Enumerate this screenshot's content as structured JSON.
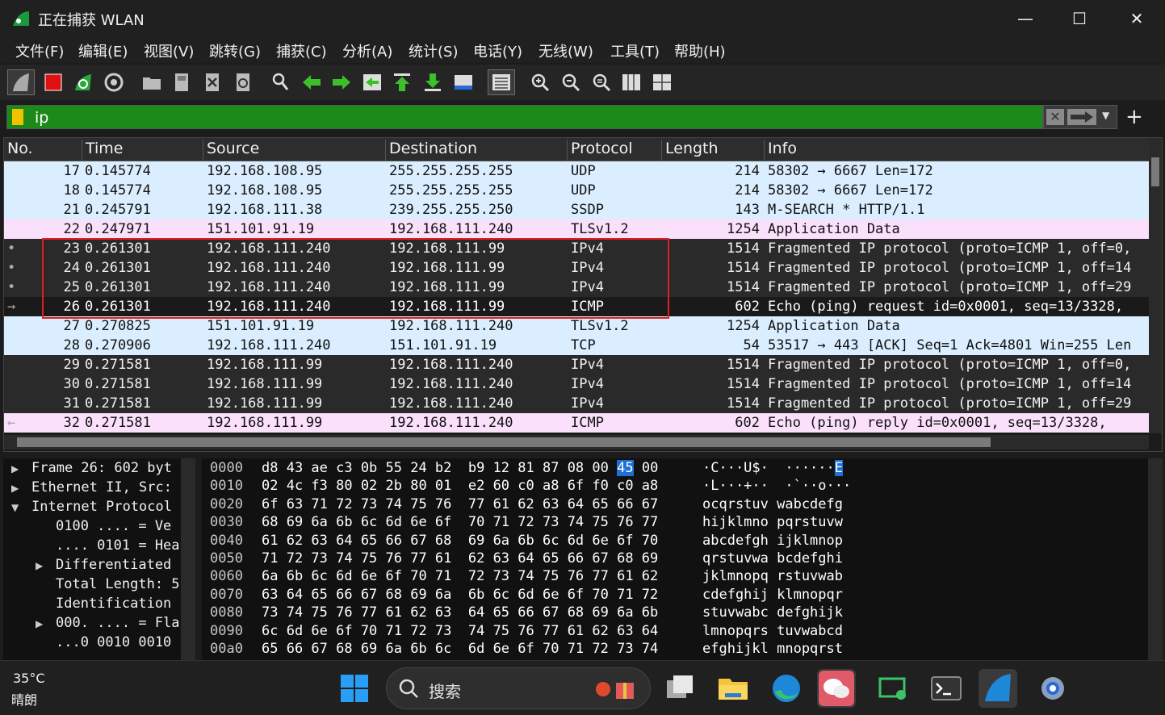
{
  "window": {
    "title": "正在捕获 WLAN",
    "minimize": "—",
    "maximize": "☐",
    "close": "✕"
  },
  "menu": [
    "文件(F)",
    "编辑(E)",
    "视图(V)",
    "跳转(G)",
    "捕获(C)",
    "分析(A)",
    "统计(S)",
    "电话(Y)",
    "无线(W)",
    "工具(T)",
    "帮助(H)"
  ],
  "toolbar_icons": [
    "shark-fin-icon",
    "stop-capture-icon",
    "restart-capture-icon",
    "capture-options-icon",
    "open-folder-icon",
    "save-file-icon",
    "close-file-icon",
    "reload-icon",
    "find-packet-icon",
    "go-back-icon",
    "go-forward-icon",
    "go-to-packet-icon",
    "go-first-icon",
    "go-last-icon",
    "autoscroll-icon",
    "colorize-icon",
    "zoom-in-icon",
    "zoom-out-icon",
    "zoom-reset-icon",
    "resize-columns-icon",
    "byte-view-icon"
  ],
  "filter": {
    "value": "ip",
    "clear": "✕",
    "add": "+"
  },
  "columns": [
    "No.",
    "Time",
    "Source",
    "Destination",
    "Protocol",
    "Length",
    "Info"
  ],
  "packets": [
    {
      "no": "17",
      "time": "0.145774",
      "src": "192.168.108.95",
      "dst": "255.255.255.255",
      "proto": "UDP",
      "len": "214",
      "info": "58302 → 6667 Len=172",
      "style": "light",
      "marker": ""
    },
    {
      "no": "18",
      "time": "0.145774",
      "src": "192.168.108.95",
      "dst": "255.255.255.255",
      "proto": "UDP",
      "len": "214",
      "info": "58302 → 6667 Len=172",
      "style": "light",
      "marker": ""
    },
    {
      "no": "21",
      "time": "0.245791",
      "src": "192.168.111.38",
      "dst": "239.255.255.250",
      "proto": "SSDP",
      "len": "143",
      "info": "M-SEARCH * HTTP/1.1",
      "style": "light",
      "marker": ""
    },
    {
      "no": "22",
      "time": "0.247971",
      "src": "151.101.91.19",
      "dst": "192.168.111.240",
      "proto": "TLSv1.2",
      "len": "1254",
      "info": "Application Data",
      "style": "pink",
      "marker": ""
    },
    {
      "no": "23",
      "time": "0.261301",
      "src": "192.168.111.240",
      "dst": "192.168.111.99",
      "proto": "IPv4",
      "len": "1514",
      "info": "Fragmented IP protocol (proto=ICMP 1, off=0,",
      "style": "dark",
      "marker": "•"
    },
    {
      "no": "24",
      "time": "0.261301",
      "src": "192.168.111.240",
      "dst": "192.168.111.99",
      "proto": "IPv4",
      "len": "1514",
      "info": "Fragmented IP protocol (proto=ICMP 1, off=14",
      "style": "dark",
      "marker": "•"
    },
    {
      "no": "25",
      "time": "0.261301",
      "src": "192.168.111.240",
      "dst": "192.168.111.99",
      "proto": "IPv4",
      "len": "1514",
      "info": "Fragmented IP protocol (proto=ICMP 1, off=29",
      "style": "dark",
      "marker": "•"
    },
    {
      "no": "26",
      "time": "0.261301",
      "src": "192.168.111.240",
      "dst": "192.168.111.99",
      "proto": "ICMP",
      "len": "602",
      "info": "Echo (ping) request  id=0x0001, seq=13/3328,",
      "style": "selected",
      "marker": "→"
    },
    {
      "no": "27",
      "time": "0.270825",
      "src": "151.101.91.19",
      "dst": "192.168.111.240",
      "proto": "TLSv1.2",
      "len": "1254",
      "info": "Application Data",
      "style": "light",
      "marker": ""
    },
    {
      "no": "28",
      "time": "0.270906",
      "src": "192.168.111.240",
      "dst": "151.101.91.19",
      "proto": "TCP",
      "len": "54",
      "info": "53517 → 443 [ACK] Seq=1 Ack=4801 Win=255 Len",
      "style": "light",
      "marker": ""
    },
    {
      "no": "29",
      "time": "0.271581",
      "src": "192.168.111.99",
      "dst": "192.168.111.240",
      "proto": "IPv4",
      "len": "1514",
      "info": "Fragmented IP protocol (proto=ICMP 1, off=0,",
      "style": "dark",
      "marker": ""
    },
    {
      "no": "30",
      "time": "0.271581",
      "src": "192.168.111.99",
      "dst": "192.168.111.240",
      "proto": "IPv4",
      "len": "1514",
      "info": "Fragmented IP protocol (proto=ICMP 1, off=14",
      "style": "dark",
      "marker": ""
    },
    {
      "no": "31",
      "time": "0.271581",
      "src": "192.168.111.99",
      "dst": "192.168.111.240",
      "proto": "IPv4",
      "len": "1514",
      "info": "Fragmented IP protocol (proto=ICMP 1, off=29",
      "style": "dark",
      "marker": ""
    },
    {
      "no": "32",
      "time": "0.271581",
      "src": "192.168.111.99",
      "dst": "192.168.111.240",
      "proto": "ICMP",
      "len": "602",
      "info": "Echo (ping) reply    id=0x0001, seq=13/3328,",
      "style": "pink",
      "marker": "←"
    }
  ],
  "details": [
    {
      "text": "Frame 26: 602 byt",
      "arrow": "▶"
    },
    {
      "text": "Ethernet II, Src:",
      "arrow": "▶"
    },
    {
      "text": "Internet Protocol",
      "arrow": "▼"
    },
    {
      "text": "0100 .... = Ve",
      "arrow": ""
    },
    {
      "text": ".... 0101 = Hea",
      "arrow": ""
    },
    {
      "text": "Differentiated",
      "arrow": "▶"
    },
    {
      "text": "Total Length: 5",
      "arrow": ""
    },
    {
      "text": "Identification",
      "arrow": ""
    },
    {
      "text": "000. .... = Fla",
      "arrow": "▶"
    },
    {
      "text": "...0 0010 0010",
      "arrow": ""
    }
  ],
  "hex": [
    {
      "off": "0000",
      "h1": "d8 43 ae c3 0b 55 24 b2  b9 12 81 87 08 00 ",
      "hl": "45",
      "h2": " 00",
      "a1": "·C···U$·  ······",
      "ahl": "E"
    },
    {
      "off": "0010",
      "h1": "02 4c f3 80 02 2b 80 01  e2 60 c0 a8 6f f0 c0 a8",
      "hl": "",
      "h2": "",
      "a1": "·L···+··  ·`··o···",
      "ahl": ""
    },
    {
      "off": "0020",
      "h1": "6f 63 71 72 73 74 75 76  77 61 62 63 64 65 66 67",
      "hl": "",
      "h2": "",
      "a1": "ocqrstuv wabcdefg",
      "ahl": ""
    },
    {
      "off": "0030",
      "h1": "68 69 6a 6b 6c 6d 6e 6f  70 71 72 73 74 75 76 77",
      "hl": "",
      "h2": "",
      "a1": "hijklmno pqrstuvw",
      "ahl": ""
    },
    {
      "off": "0040",
      "h1": "61 62 63 64 65 66 67 68  69 6a 6b 6c 6d 6e 6f 70",
      "hl": "",
      "h2": "",
      "a1": "abcdefgh ijklmnop",
      "ahl": ""
    },
    {
      "off": "0050",
      "h1": "71 72 73 74 75 76 77 61  62 63 64 65 66 67 68 69",
      "hl": "",
      "h2": "",
      "a1": "qrstuvwa bcdefghi",
      "ahl": ""
    },
    {
      "off": "0060",
      "h1": "6a 6b 6c 6d 6e 6f 70 71  72 73 74 75 76 77 61 62",
      "hl": "",
      "h2": "",
      "a1": "jklmnopq rstuvwab",
      "ahl": ""
    },
    {
      "off": "0070",
      "h1": "63 64 65 66 67 68 69 6a  6b 6c 6d 6e 6f 70 71 72",
      "hl": "",
      "h2": "",
      "a1": "cdefghij klmnopqr",
      "ahl": ""
    },
    {
      "off": "0080",
      "h1": "73 74 75 76 77 61 62 63  64 65 66 67 68 69 6a 6b",
      "hl": "",
      "h2": "",
      "a1": "stuvwabc defghijk",
      "ahl": ""
    },
    {
      "off": "0090",
      "h1": "6c 6d 6e 6f 70 71 72 73  74 75 76 77 61 62 63 64",
      "hl": "",
      "h2": "",
      "a1": "lmnopqrs tuvwabcd",
      "ahl": ""
    },
    {
      "off": "00a0",
      "h1": "65 66 67 68 69 6a 6b 6c  6d 6e 6f 70 71 72 73 74",
      "hl": "",
      "h2": "",
      "a1": "efghijkl mnopqrst",
      "ahl": ""
    }
  ],
  "taskbar": {
    "temp": "35°C",
    "weather": "晴朗",
    "search": "搜索",
    "apps": [
      "windows-start-icon",
      "task-view-icon",
      "file-explorer-icon",
      "edge-browser-icon",
      "wechat-icon",
      "remote-connect-icon",
      "terminal-icon",
      "wireshark-icon",
      "settings-icon"
    ]
  },
  "colors": {
    "light_row": "#daeeff",
    "pink_row": "#fae0fa",
    "dark_row": "#2a2a2a",
    "filter_ok": "#1b8a1b",
    "highlight": "#1e6fd6",
    "annotation": "#e02020"
  }
}
